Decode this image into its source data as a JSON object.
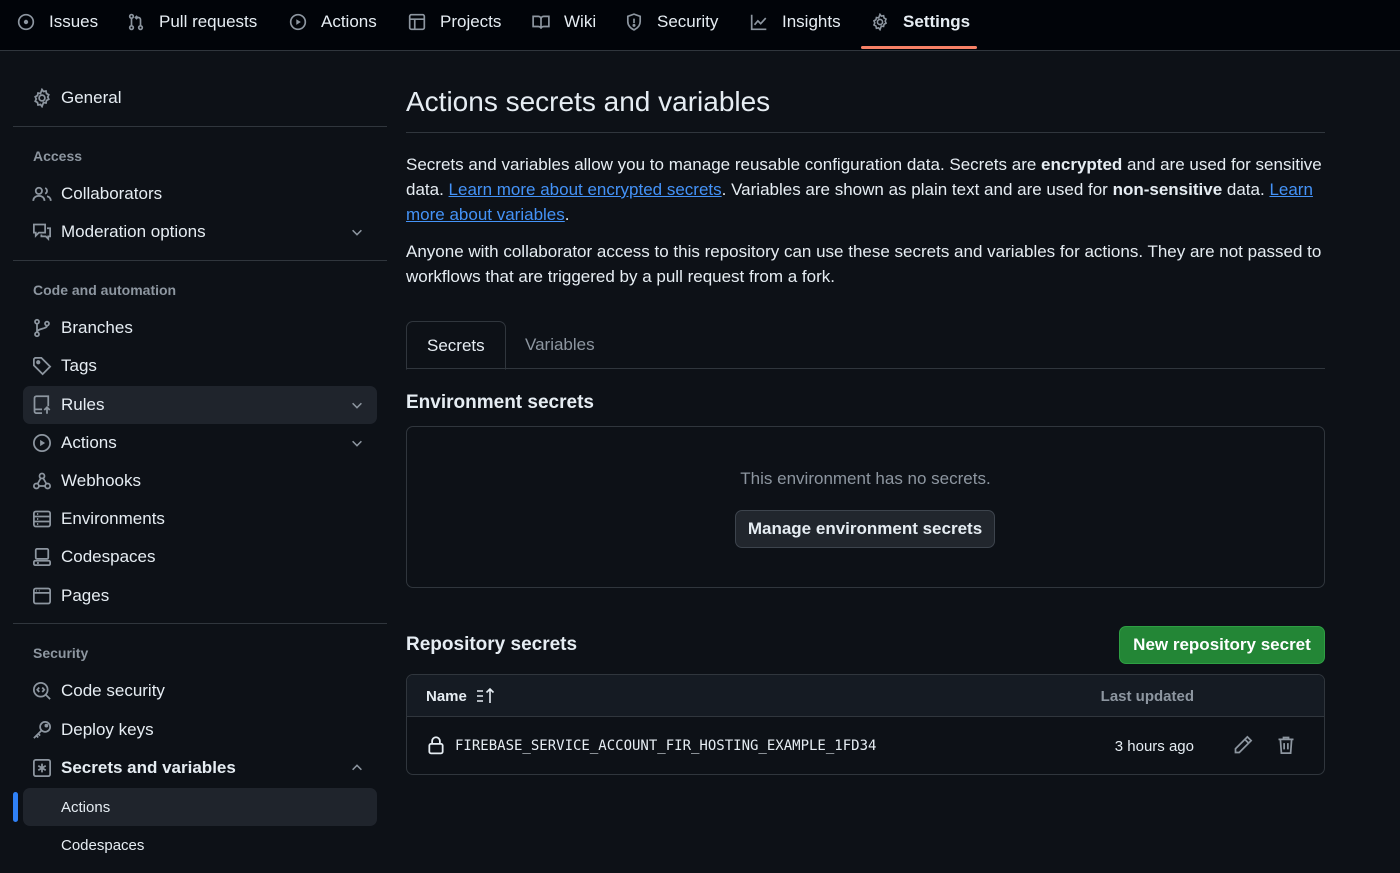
{
  "topnav": {
    "tabs": [
      {
        "label": "Issues",
        "icon": "issue-icon"
      },
      {
        "label": "Pull requests",
        "icon": "pull-request-icon"
      },
      {
        "label": "Actions",
        "icon": "play-icon"
      },
      {
        "label": "Projects",
        "icon": "table-icon"
      },
      {
        "label": "Wiki",
        "icon": "book-icon"
      },
      {
        "label": "Security",
        "icon": "shield-icon"
      },
      {
        "label": "Insights",
        "icon": "graph-icon"
      },
      {
        "label": "Settings",
        "icon": "gear-icon"
      }
    ],
    "active_tab": "Settings"
  },
  "sidebar": {
    "general": "General",
    "access_heading": "Access",
    "collaborators": "Collaborators",
    "moderation": "Moderation options",
    "code_heading": "Code and automation",
    "branches": "Branches",
    "tags": "Tags",
    "rules": "Rules",
    "actions": "Actions",
    "webhooks": "Webhooks",
    "environments": "Environments",
    "codespaces": "Codespaces",
    "pages": "Pages",
    "security_heading": "Security",
    "code_security": "Code security",
    "deploy_keys": "Deploy keys",
    "secrets_vars": "Secrets and variables",
    "sub_actions": "Actions",
    "sub_codespaces": "Codespaces"
  },
  "main": {
    "title": "Actions secrets and variables",
    "intro": {
      "p1_a": "Secrets and variables allow you to manage reusable configuration data. Secrets are ",
      "p1_b": "encrypted",
      "p1_c": " and are used for sensitive data. ",
      "p1_link1": "Learn more about encrypted secrets",
      "p1_d": ". Variables are shown as plain text and are used for ",
      "p1_e": "non-sensitive",
      "p1_f": " data. ",
      "p1_link2": "Learn more about variables",
      "p1_g": ".",
      "p2": "Anyone with collaborator access to this repository can use these secrets and variables for actions. They are not passed to workflows that are triggered by a pull request from a fork."
    },
    "tabs": {
      "secrets": "Secrets",
      "variables": "Variables"
    },
    "env_heading": "Environment secrets",
    "env_empty": "This environment has no secrets.",
    "env_button": "Manage environment secrets",
    "repo_heading": "Repository secrets",
    "new_button": "New repository secret",
    "table": {
      "col_name": "Name",
      "col_updated": "Last updated",
      "rows": [
        {
          "name": "FIREBASE_SERVICE_ACCOUNT_FIR_HOSTING_EXAMPLE_1FD34",
          "updated": "3 hours ago"
        }
      ]
    }
  },
  "colors": {
    "accent_tab": "#f78166",
    "link": "#4493f8",
    "primary_button": "#238636",
    "active_indicator": "#2f81f7"
  }
}
